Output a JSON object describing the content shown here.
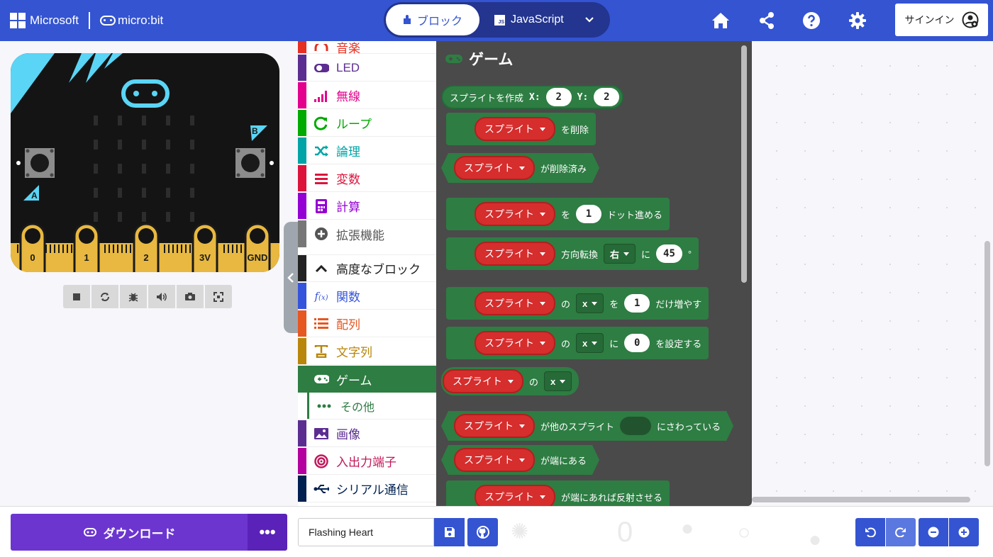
{
  "header": {
    "brand_ms": "Microsoft",
    "brand_mb": "micro:bit",
    "mode_blocks": "ブロック",
    "mode_js": "JavaScript",
    "js_badge": "JS",
    "signin": "サインイン",
    "colors": {
      "header": "#3454d1",
      "toggle": "#23358f"
    }
  },
  "simulator": {
    "button_a": "A",
    "button_b": "B",
    "pins": [
      "0",
      "1",
      "2",
      "3V",
      "GND"
    ],
    "toolbar_icons": [
      "stop-icon",
      "restart-icon",
      "debug-icon",
      "sound-icon",
      "screenshot-icon",
      "fullscreen-icon"
    ]
  },
  "toolbox": {
    "items": [
      {
        "label": "音楽",
        "color": "#e63022",
        "icon": "headphones-icon"
      },
      {
        "label": "LED",
        "color": "#5c2d91",
        "icon": "toggle-icon"
      },
      {
        "label": "無線",
        "color": "#e3008c",
        "icon": "signal-icon"
      },
      {
        "label": "ループ",
        "color": "#00aa00",
        "icon": "loop-icon"
      },
      {
        "label": "論理",
        "color": "#00a4a6",
        "icon": "shuffle-icon"
      },
      {
        "label": "変数",
        "color": "#dc143c",
        "icon": "list-icon"
      },
      {
        "label": "計算",
        "color": "#9400d3",
        "icon": "calculator-icon"
      },
      {
        "label": "拡張機能",
        "color": "#777777",
        "icon": "plus-circle-icon"
      },
      {
        "label": "高度なブロック",
        "color": "#222222",
        "icon": "chevron-up-icon"
      },
      {
        "label": "関数",
        "color": "#3455db",
        "icon": "function-icon"
      },
      {
        "label": "配列",
        "color": "#e65722",
        "icon": "array-icon"
      },
      {
        "label": "文字列",
        "color": "#b8860b",
        "icon": "text-icon"
      },
      {
        "label": "ゲーム",
        "color": "#2e7d43",
        "icon": "gamepad-icon"
      },
      {
        "label": "その他",
        "color": "#2e7d43",
        "icon": "dots-icon"
      },
      {
        "label": "画像",
        "color": "#5c2d91",
        "icon": "image-icon"
      },
      {
        "label": "入出力端子",
        "color": "#b4009e",
        "icon": "target-icon"
      },
      {
        "label": "シリアル通信",
        "color": "#002050",
        "icon": "usb-icon"
      }
    ]
  },
  "flyout": {
    "title": "ゲーム",
    "sprite": "スプライト",
    "create": {
      "label": "スプライトを作成",
      "x_label": "X:",
      "x": "2",
      "y_label": "Y:",
      "y": "2"
    },
    "delete_label": "を削除",
    "deleted_label": "が削除済み",
    "move": {
      "pre": "を",
      "value": "1",
      "post": "ドット進める"
    },
    "turn": {
      "label": "方向転換",
      "dir": "右",
      "pre": "に",
      "value": "45",
      "deg": "°"
    },
    "change": {
      "of": "の",
      "prop": "x",
      "pre": "を",
      "value": "1",
      "post": "だけ増やす"
    },
    "set": {
      "of": "の",
      "prop": "x",
      "pre": "に",
      "value": "0",
      "post": "を設定する"
    },
    "get": {
      "of": "の",
      "prop": "x"
    },
    "touching": {
      "pre": "が他のスプライト",
      "post": "にさわっている"
    },
    "on_edge": "が端にある",
    "bounce": "が端にあれば反射させる"
  },
  "footer": {
    "download": "ダウンロード",
    "more": "•••",
    "project_name": "Flashing Heart"
  }
}
